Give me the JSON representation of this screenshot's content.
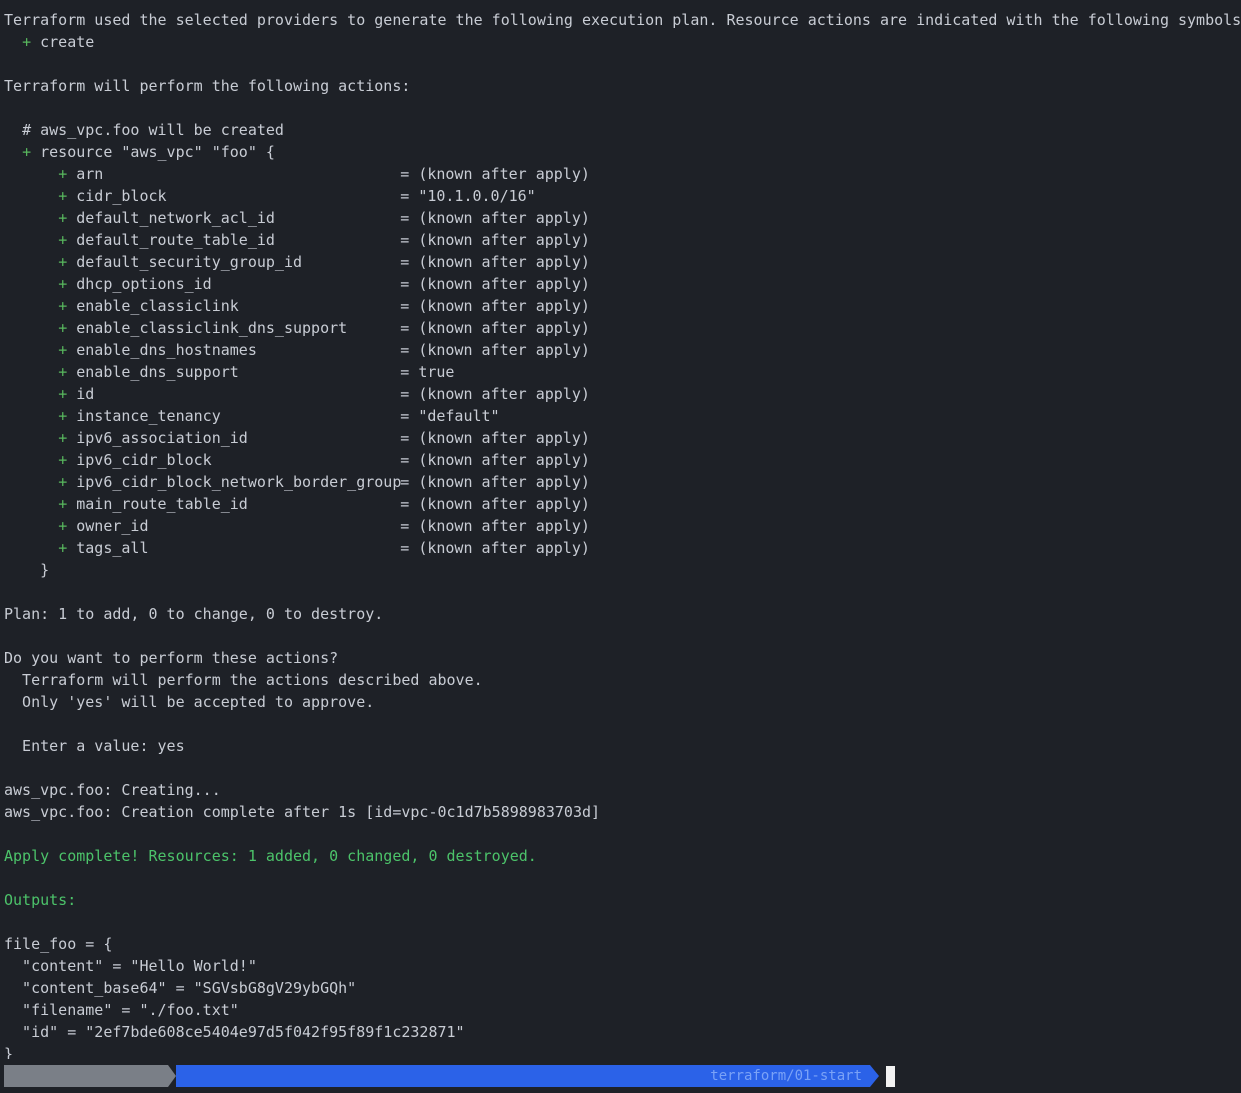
{
  "plan_intro": {
    "line1": "Terraform used the selected providers to generate the following execution plan. Resource actions are indicated with the following symbols:",
    "symbol": "+",
    "symbol_label": "create"
  },
  "actions_heading": "Terraform will perform the following actions:",
  "resource": {
    "comment": "# aws_vpc.foo will be created",
    "plus": "+",
    "declaration": "resource \"aws_vpc\" \"foo\" {",
    "attributes": [
      {
        "key": "arn",
        "value": "(known after apply)"
      },
      {
        "key": "cidr_block",
        "value": "\"10.1.0.0/16\""
      },
      {
        "key": "default_network_acl_id",
        "value": "(known after apply)"
      },
      {
        "key": "default_route_table_id",
        "value": "(known after apply)"
      },
      {
        "key": "default_security_group_id",
        "value": "(known after apply)"
      },
      {
        "key": "dhcp_options_id",
        "value": "(known after apply)"
      },
      {
        "key": "enable_classiclink",
        "value": "(known after apply)"
      },
      {
        "key": "enable_classiclink_dns_support",
        "value": "(known after apply)"
      },
      {
        "key": "enable_dns_hostnames",
        "value": "(known after apply)"
      },
      {
        "key": "enable_dns_support",
        "value": "true"
      },
      {
        "key": "id",
        "value": "(known after apply)"
      },
      {
        "key": "instance_tenancy",
        "value": "\"default\""
      },
      {
        "key": "ipv6_association_id",
        "value": "(known after apply)"
      },
      {
        "key": "ipv6_cidr_block",
        "value": "(known after apply)"
      },
      {
        "key": "ipv6_cidr_block_network_border_group",
        "value": "(known after apply)"
      },
      {
        "key": "main_route_table_id",
        "value": "(known after apply)"
      },
      {
        "key": "owner_id",
        "value": "(known after apply)"
      },
      {
        "key": "tags_all",
        "value": "(known after apply)"
      }
    ],
    "close": "}"
  },
  "plan_summary": "Plan: 1 to add, 0 to change, 0 to destroy.",
  "prompt": {
    "question": "Do you want to perform these actions?",
    "info1": "  Terraform will perform the actions described above.",
    "info2": "  Only 'yes' will be accepted to approve.",
    "enter_label": "  Enter a value: ",
    "enter_value": "yes"
  },
  "progress": {
    "creating": "aws_vpc.foo: Creating...",
    "complete": "aws_vpc.foo: Creation complete after 1s [id=vpc-0c1d7b5898983703d]"
  },
  "apply_complete": "Apply complete! Resources: 1 added, 0 changed, 0 destroyed.",
  "outputs_heading": "Outputs:",
  "outputs": {
    "open": "file_foo = {",
    "entries": [
      "  \"content\" = \"Hello World!\"",
      "  \"content_base64\" = \"SGVsbG8gV29ybGQh\"",
      "  \"filename\" = \"./foo.txt\"",
      "  \"id\" = \"2ef7bde608ce5404e97d5f042f95f89f1c232871\""
    ],
    "close": "}"
  },
  "statusbar": {
    "path_suffix": "terraform/01-start"
  },
  "colors": {
    "background": "#1e2127",
    "text": "#c8ccd4",
    "plus": "#58b85e",
    "success": "#4cc36a",
    "path_segment": "#2b62e8"
  }
}
